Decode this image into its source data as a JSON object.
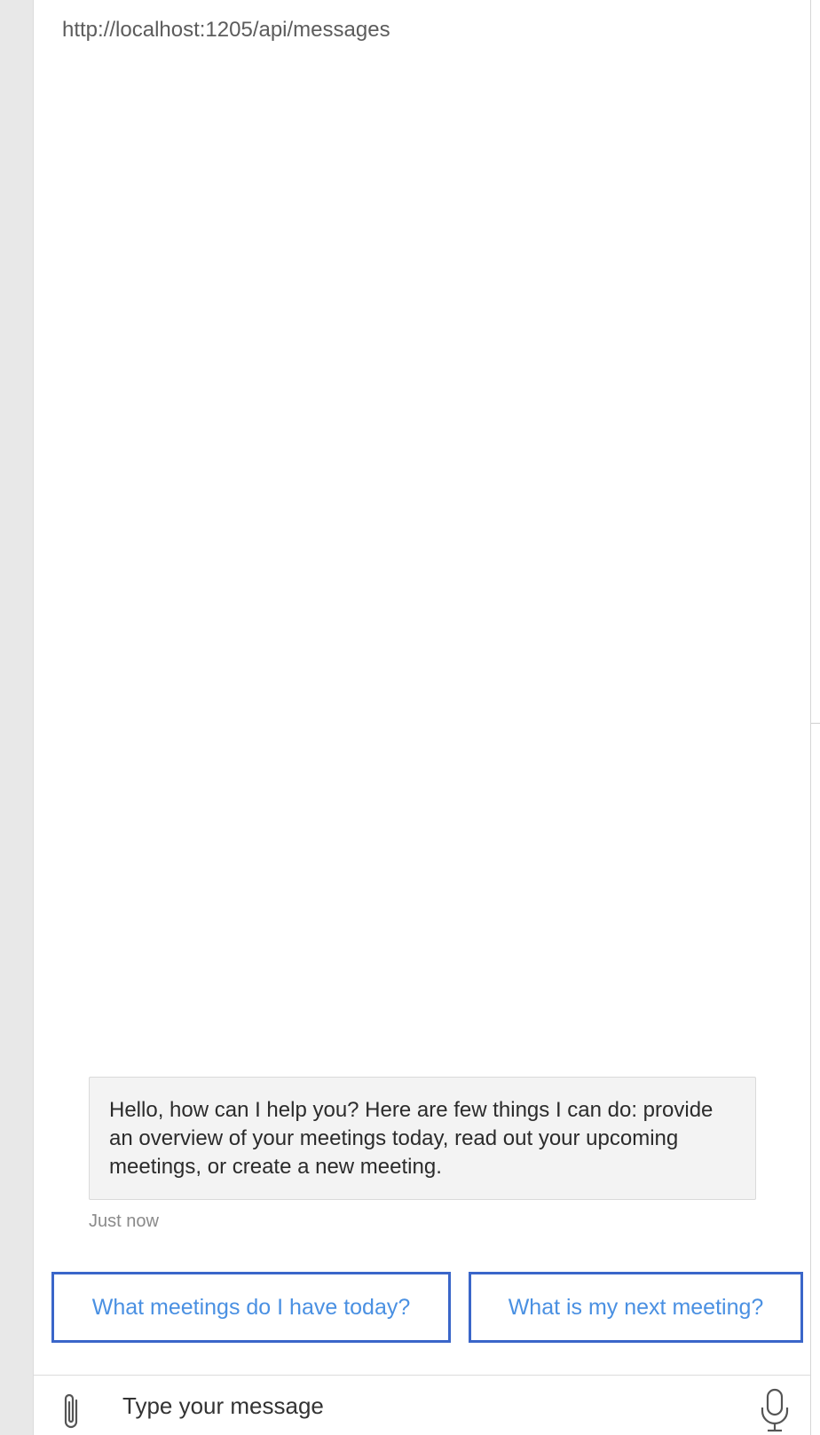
{
  "header": {
    "endpoint_url": "http://localhost:1205/api/messages"
  },
  "conversation": {
    "bot_message": "Hello, how can I help you? Here are few things I can do: provide an overview of your meetings today, read out your upcoming meetings, or create a new meeting.",
    "timestamp": "Just now"
  },
  "suggested_actions": [
    {
      "label": "What meetings do I have today?"
    },
    {
      "label": "What is my next meeting?"
    }
  ],
  "composer": {
    "placeholder": "Type your message",
    "attach_icon": "paperclip-icon",
    "mic_icon": "microphone-icon"
  },
  "colors": {
    "accent_border": "#3a66c9",
    "action_text": "#4a90e2",
    "bubble_bg": "#f3f3f3"
  }
}
